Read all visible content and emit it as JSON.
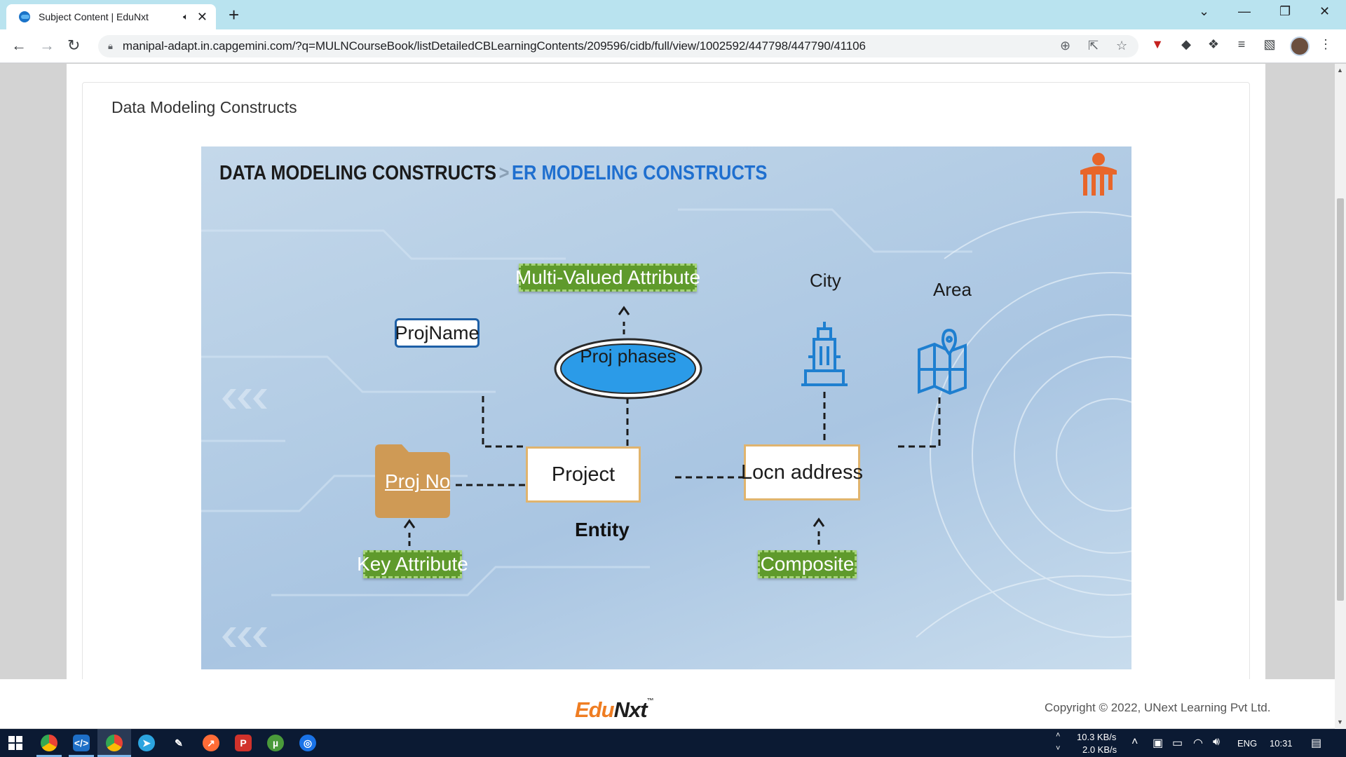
{
  "browser": {
    "tab_title": "Subject Content | EduNxt",
    "url": "manipal-adapt.in.capgemini.com/?q=MULNCourseBook/listDetailedCBLearningContents/209596/cidb/full/view/1002592/447798/447790/41106"
  },
  "page": {
    "card_title": "Data Modeling Constructs"
  },
  "slide": {
    "heading_main": "DATA MODELING CONSTRUCTS",
    "heading_sep": ">",
    "heading_sub": "ER MODELING CONSTRUCTS",
    "multi_valued_label": "Multi-Valued Attribute",
    "projname_label": "ProjName",
    "proj_phases_label": "Proj phases",
    "city_label": "City",
    "area_label": "Area",
    "proj_no_label": "Proj No",
    "project_label": "Project",
    "locn_address_label": "Locn address",
    "entity_label": "Entity",
    "key_attribute_label": "Key Attribute",
    "composite_label": "Composite"
  },
  "footer": {
    "logo_edu": "Edu",
    "logo_nxt": "Nxt",
    "logo_tm": "™",
    "copyright": "Copyright © 2022, UNext Learning Pvt Ltd."
  },
  "taskbar": {
    "net_up": "10.3 KB/s",
    "net_down": "2.0 KB/s",
    "language": "ENG",
    "time": "10:31"
  },
  "colors": {
    "tabstrip": "#b9e3ef",
    "green_box": "#5f9a2c",
    "heading_blue": "#1f6fcf",
    "ellipse_blue": "#2b9be8",
    "folder_tan": "#cf9a55",
    "edu_orange": "#ef7d22"
  }
}
